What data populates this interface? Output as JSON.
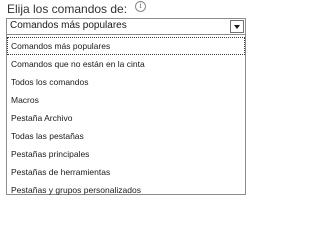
{
  "commands": {
    "label": "Elija los comandos de:",
    "info_icon": "info-icon",
    "selected_value": "Comandos más populares",
    "options": [
      "Comandos más populares",
      "Comandos que no están en la cinta",
      "Todos los comandos",
      "Macros",
      "Pestaña Archivo",
      "Todas las pestañas",
      "Pestañas principales",
      "Pestañas de herramientas",
      "Pestañas y grupos personalizados"
    ],
    "selected_index": 0
  }
}
